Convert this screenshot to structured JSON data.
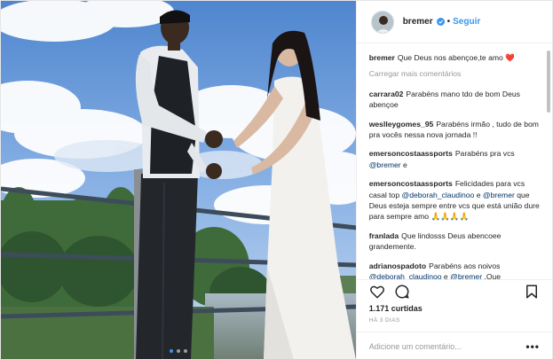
{
  "post": {
    "author": {
      "username": "bremer",
      "verified": true,
      "follow_label": "Seguir",
      "separator": "•"
    },
    "caption": {
      "user": "bremer",
      "text": "Que Deus nos abençoe,te amo ❤️"
    },
    "load_more_label": "Carregar mais comentários",
    "comments": [
      {
        "user": "carrara02",
        "parts": [
          {
            "t": "Parabéns mano tdo de bom Deus abençoe"
          }
        ]
      },
      {
        "user": "wesllеygomes_95",
        "parts": [
          {
            "t": "Parabéns irmão , tudo de bom pra vocês nessa nova jornada !!"
          }
        ]
      },
      {
        "user": "emersoncostaassports",
        "parts": [
          {
            "t": "Parabéns pra vcs "
          },
          {
            "m": "@bremer"
          },
          {
            "t": " e"
          }
        ]
      },
      {
        "user": "emersoncostaassports",
        "parts": [
          {
            "t": "Felicidades para vcs casal top "
          },
          {
            "m": "@deborah_claudinoo"
          },
          {
            "t": " e "
          },
          {
            "m": "@bremer"
          },
          {
            "t": " que Deus esteja sempre entre vcs que está união dure para sempre amo 🙏🙏🙏🙏"
          }
        ]
      },
      {
        "user": "franlada",
        "parts": [
          {
            "t": "Que lindosss Deus abencoee grandemente."
          }
        ]
      },
      {
        "user": "adrianospadoto",
        "parts": [
          {
            "t": "Parabéns aos noivos "
          },
          {
            "m": "@deborah_claudinoo"
          },
          {
            "t": " e "
          },
          {
            "m": "@bremer"
          },
          {
            "t": " .Que"
          }
        ]
      }
    ],
    "likes": "1.171 curtidas",
    "date": "HÁ 3 DIAS",
    "add_comment_placeholder": "Adicione um comentário...",
    "more_label": "•••",
    "carousel": {
      "count": 3,
      "active": 0
    }
  },
  "colors": {
    "link": "#3897f0",
    "mention": "#003569",
    "text": "#262626",
    "muted": "#999999"
  },
  "icons": [
    "heart-icon",
    "comment-icon",
    "bookmark-icon",
    "verified-badge-icon"
  ]
}
